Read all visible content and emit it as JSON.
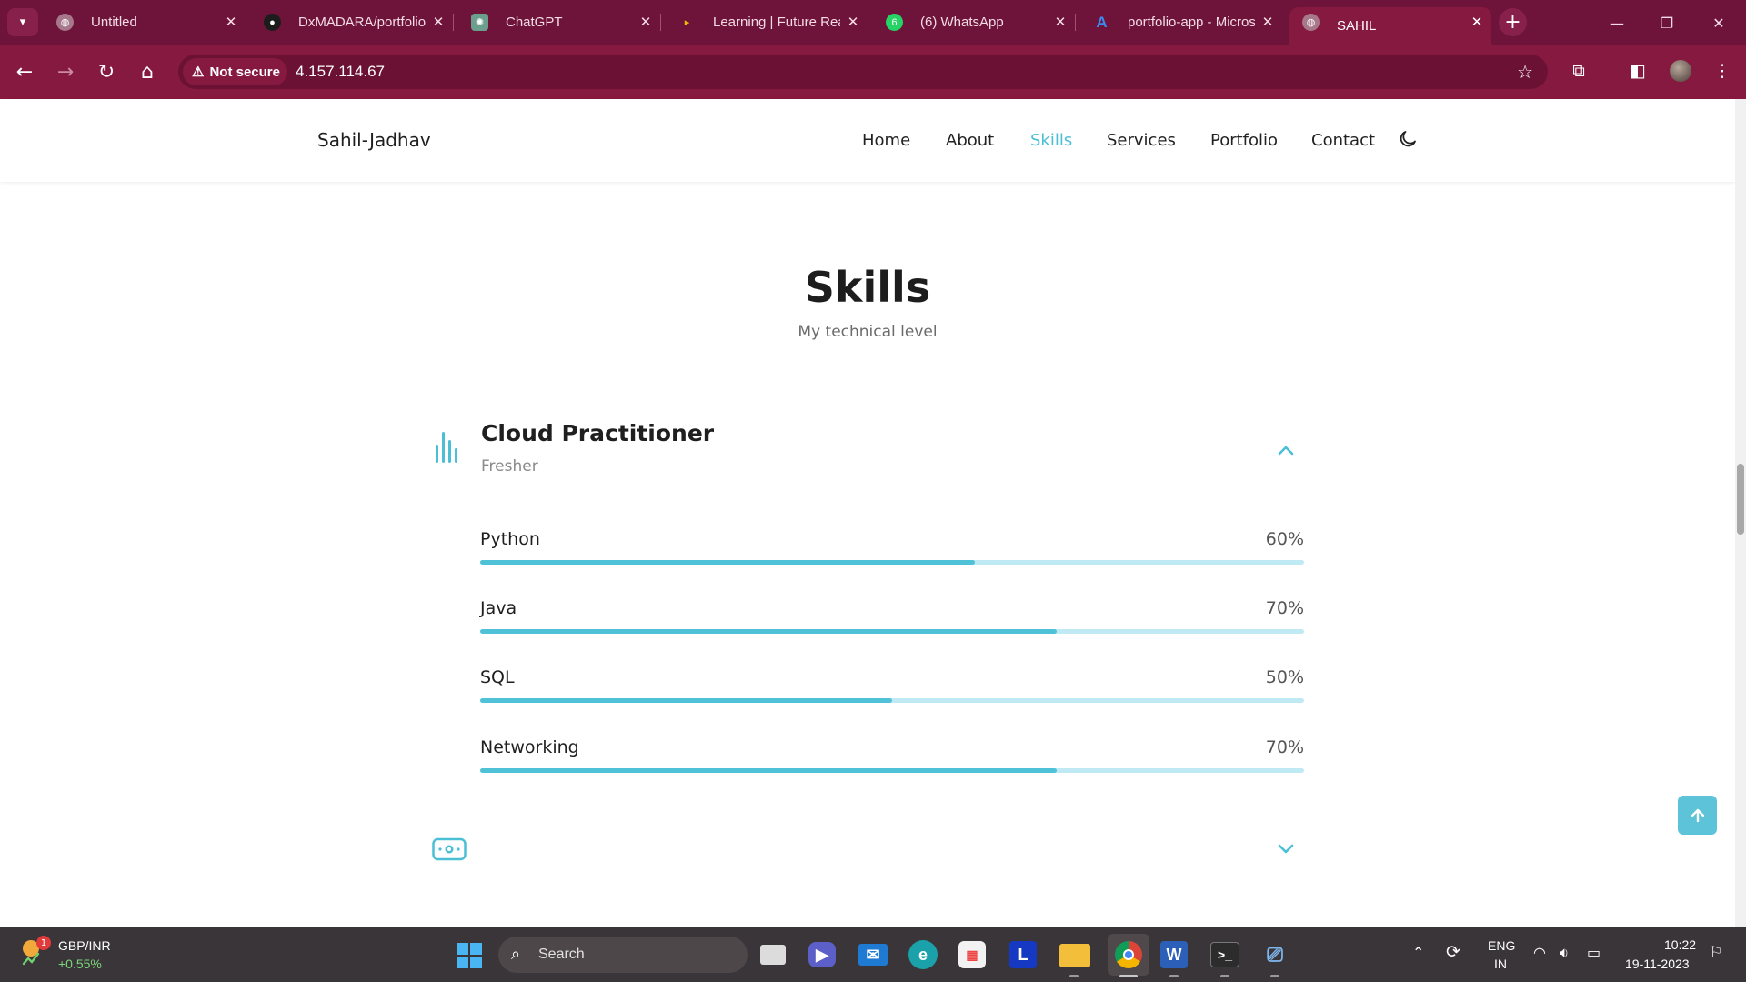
{
  "browser": {
    "tabs": [
      {
        "title": "Untitled",
        "active": false
      },
      {
        "title": "DxMADARA/portfolio",
        "active": false
      },
      {
        "title": "ChatGPT",
        "active": false
      },
      {
        "title": "Learning | Future Ready",
        "active": false
      },
      {
        "title": "(6) WhatsApp",
        "active": false
      },
      {
        "title": "portfolio-app - Microsoft Azure",
        "active": false
      },
      {
        "title": "SAHIL",
        "active": true
      }
    ],
    "security_label": "Not secure",
    "url": "4.157.114.67",
    "accent": "#86193f"
  },
  "site": {
    "logo": "Sahil-Jadhav",
    "nav": [
      "Home",
      "About",
      "Skills",
      "Services",
      "Portfolio",
      "Contact"
    ],
    "active_nav": "Skills",
    "accent": "#4bbfd6"
  },
  "skills": {
    "title": "Skills",
    "subtitle": "My technical level",
    "category": {
      "title": "Cloud Practitioner",
      "level": "Fresher",
      "items": [
        {
          "name": "Python",
          "percent_label": "60%",
          "percent": 60
        },
        {
          "name": "Java",
          "percent_label": "70%",
          "percent": 70
        },
        {
          "name": "SQL",
          "percent_label": "50%",
          "percent": 50
        },
        {
          "name": "Networking",
          "percent_label": "70%",
          "percent": 70
        }
      ]
    }
  },
  "taskbar": {
    "ticker_name": "GBP/INR",
    "ticker_change": "+0.55%",
    "ticker_badge": "1",
    "search_placeholder": "Search",
    "lang_top": "ENG",
    "lang_bottom": "IN",
    "time": "10:22",
    "date": "19-11-2023"
  }
}
